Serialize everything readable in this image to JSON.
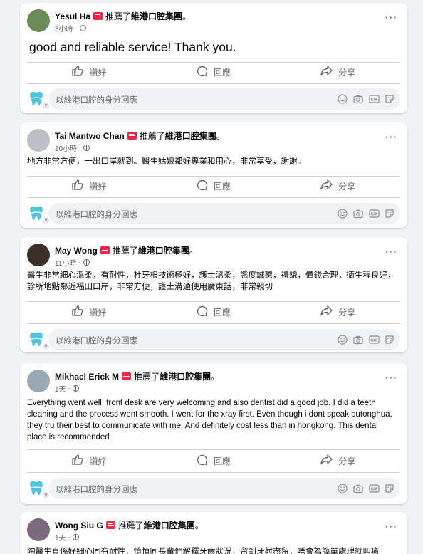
{
  "actions": {
    "like": "讚好",
    "comment": "回應",
    "share": "分享"
  },
  "comment_placeholder": "以維港口腔的身分回應",
  "recommend_text": "推薦了",
  "page_name": "維港口腔集團",
  "colors": {
    "recommend_badge": "#f02849",
    "secondary_text": "#65676b",
    "card_bg": "#ffffff",
    "feed_bg": "#f0f2f5",
    "page_logo": "#4fc3d9"
  },
  "reviews": [
    {
      "name": "Yesul Ha",
      "time": "3小時",
      "text": "good and reliable service! Thank you.",
      "large_text": true,
      "avatar_color": "#6b8a5a"
    },
    {
      "name": "Tai Mantwo Chan",
      "time": "10小時",
      "text": "地方非常方便，一出口岸就到。醫生姑娘都好專業和用心，非常享受，謝謝。",
      "large_text": false,
      "avatar_color": "#bcc0c4"
    },
    {
      "name": "May Wong",
      "time": "11小時",
      "text": "醫生非常細心溫柔，有耐性，杜牙根技術極好，護士溫柔，態度誠懇，禮貌，價錢合理，衛生程良好，診所地點鄰近福田口岸，非常方便，護士溝通使用廣東話，非常親切",
      "large_text": false,
      "avatar_color": "#3b2f2a"
    },
    {
      "name": "Mikhael Erick M",
      "time": "1天",
      "text": "Everything went well, front desk are very welcoming and also dentist did a good job. I did a teeth cleaning and the process went smooth. I went for the xray first. Even though i dont speak putonghua, they tru their best to communicate with me. And definitely cost less than in hongkong. This dental place is recommended",
      "large_text": false,
      "avatar_color": "#9aa8b4"
    },
    {
      "name": "Wong Siu G",
      "time": "1天",
      "text": "陶醫生真係好細心同有耐性，慎慎同長輩們解釋牙齒狀況，留到牙射盡留，唔會為簡單處理就叫癒",
      "large_text": false,
      "avatar_color": "#7a6a80"
    }
  ]
}
